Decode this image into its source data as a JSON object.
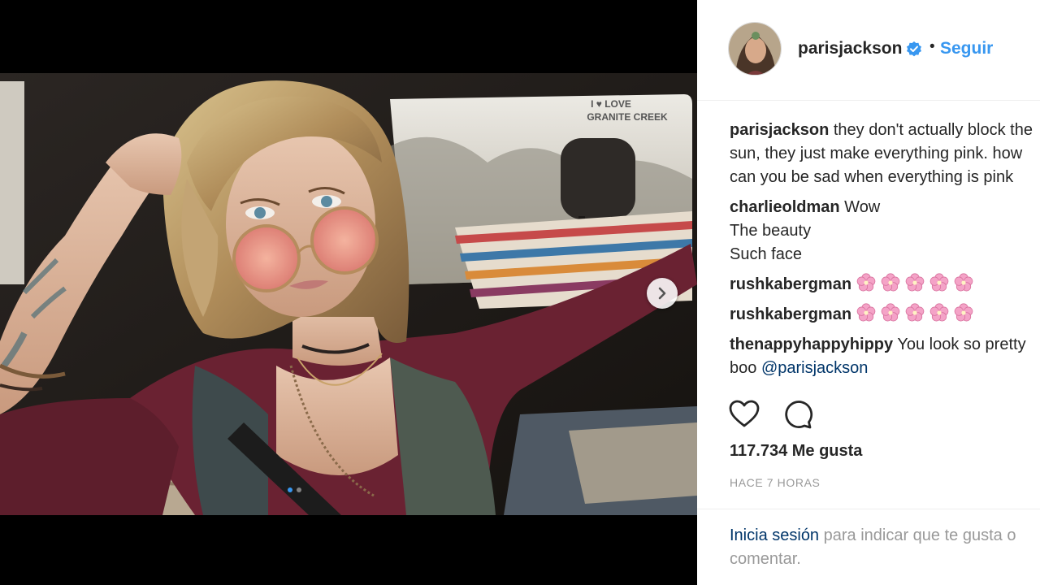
{
  "post": {
    "username": "parisjackson",
    "separator": "•",
    "follow_label": "Seguir",
    "car_sticker_line1": "I ♥ LOVE",
    "car_sticker_line2": "GRANITE CREEK"
  },
  "comments": [
    {
      "user": "parisjackson",
      "lines": [
        "they don't actually block the",
        "sun, they just make everything pink. how",
        "can you be sad when everything is pink"
      ]
    },
    {
      "user": "charlieoldman",
      "lines": [
        "Wow",
        "The beauty",
        "Such face"
      ]
    },
    {
      "user": "rushkabergman",
      "flower_count": 5
    },
    {
      "user": "rushkabergman",
      "flower_count": 5
    },
    {
      "user": "thenappyhappyhippy",
      "lines": [
        "You look so pretty",
        "boo"
      ],
      "mention": "@parisjackson"
    }
  ],
  "likes_text": "117.734 Me gusta",
  "time_text": "HACE 7 HORAS",
  "login": {
    "link_label": "Inicia sesión",
    "rest_text": " para indicar que te gusta o",
    "rest_text2": "comentar."
  },
  "icons": {
    "like": "heart-outline-icon",
    "comment": "comment-bubble-icon",
    "verified": "verified-badge-icon",
    "next": "chevron-right-icon"
  },
  "colors": {
    "accent": "#3897f0",
    "text": "#262626",
    "muted": "#999999",
    "mention": "#003569",
    "flower": "#f4a3c7"
  }
}
